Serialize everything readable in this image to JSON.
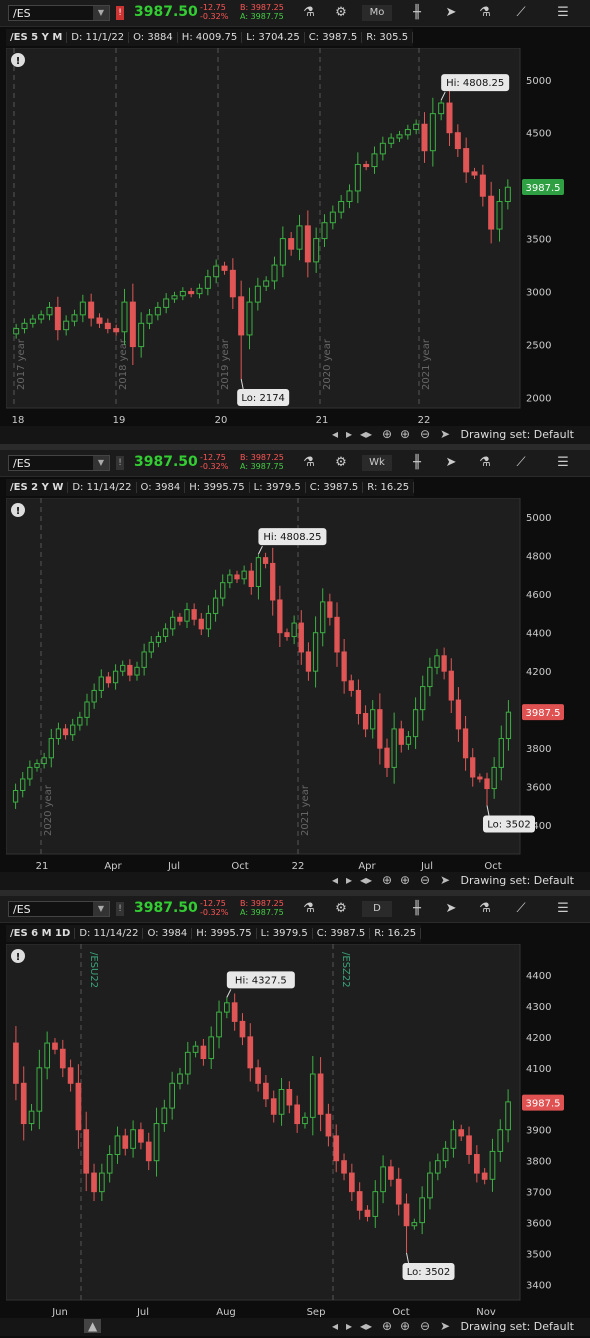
{
  "panels": [
    {
      "symbol": "/ES",
      "last": "3987.50",
      "change": "-12.75",
      "change_pct": "-0.32%",
      "bid": "B: 3987.25",
      "ask": "A: 3987.75",
      "aggregation": "Mo",
      "info": {
        "name": "/ES 5 Y M",
        "date": "D: 11/1/22",
        "open": "O: 3884",
        "high": "H: 4009.75",
        "low": "L: 3704.25",
        "close": "C: 3987.5",
        "range": "R: 305.5"
      },
      "drawing_set": "Drawing set: Default",
      "price_tag": "3987.5",
      "price_tag_color": "#2ea043",
      "hi_label": "Hi: 4808.25",
      "lo_label": "Lo: 2174"
    },
    {
      "symbol": "/ES",
      "last": "3987.50",
      "change": "-12.75",
      "change_pct": "-0.32%",
      "bid": "B: 3987.25",
      "ask": "A: 3987.75",
      "aggregation": "Wk",
      "info": {
        "name": "/ES 2 Y W",
        "date": "D: 11/14/22",
        "open": "O: 3984",
        "high": "H: 3995.75",
        "low": "L: 3979.5",
        "close": "C: 3987.5",
        "range": "R: 16.25"
      },
      "drawing_set": "Drawing set: Default",
      "price_tag": "3987.5",
      "price_tag_color": "#e05252",
      "hi_label": "Hi: 4808.25",
      "lo_label": "Lo: 3502"
    },
    {
      "symbol": "/ES",
      "last": "3987.50",
      "change": "-12.75",
      "change_pct": "-0.32%",
      "bid": "B: 3987.25",
      "ask": "A: 3987.75",
      "aggregation": "D",
      "info": {
        "name": "/ES 6 M 1D",
        "date": "D: 11/14/22",
        "open": "O: 3984",
        "high": "H: 3995.75",
        "low": "L: 3979.5",
        "close": "C: 3987.5",
        "range": "R: 16.25"
      },
      "drawing_set": "Drawing set: Default",
      "price_tag": "3987.5",
      "price_tag_color": "#e05252",
      "hi_label": "Hi: 4327.5",
      "lo_label": "Lo: 3502"
    }
  ],
  "chart_data": [
    {
      "type": "candlestick",
      "ylim": [
        1900,
        5300
      ],
      "y_ticks": [
        2000,
        2500,
        3000,
        3500,
        4000,
        4500,
        5000
      ],
      "x_ticks": [
        "18",
        "19",
        "20",
        "21",
        "22"
      ],
      "period_labels": [
        "2017 year",
        "2018 year",
        "2019 year",
        "2020 year",
        "2021 year"
      ],
      "close_path": [
        2650,
        2700,
        2740,
        2780,
        2850,
        2640,
        2720,
        2780,
        2900,
        2750,
        2700,
        2650,
        2620,
        2900,
        2480,
        2700,
        2780,
        2850,
        2930,
        2960,
        3000,
        2980,
        3030,
        3140,
        3240,
        3200,
        2950,
        2590,
        2900,
        3050,
        3100,
        3250,
        3500,
        3400,
        3620,
        3280,
        3500,
        3650,
        3750,
        3850,
        3950,
        4200,
        4180,
        4300,
        4400,
        4450,
        4480,
        4530,
        4580,
        4330,
        4680,
        4780,
        4500,
        4350,
        4130,
        4100,
        3900,
        3590,
        3850,
        3985
      ],
      "hi": 4808.25,
      "lo": 2174,
      "last": 3987.5
    },
    {
      "type": "candlestick",
      "ylim": [
        3250,
        5100
      ],
      "y_ticks": [
        3400,
        3600,
        3800,
        4000,
        4200,
        4400,
        4600,
        4800,
        5000
      ],
      "x_ticks": [
        "21",
        "Apr",
        "Jul",
        "Oct",
        "22",
        "Apr",
        "Jul",
        "Oct"
      ],
      "period_labels": [
        "2020 year",
        "2021 year"
      ],
      "close_path": [
        3580,
        3640,
        3700,
        3720,
        3750,
        3850,
        3900,
        3870,
        3920,
        3960,
        4040,
        4100,
        4170,
        4140,
        4200,
        4230,
        4180,
        4220,
        4300,
        4350,
        4380,
        4420,
        4480,
        4460,
        4520,
        4470,
        4420,
        4500,
        4580,
        4660,
        4700,
        4680,
        4720,
        4640,
        4790,
        4760,
        4570,
        4400,
        4380,
        4450,
        4300,
        4200,
        4400,
        4560,
        4480,
        4300,
        4150,
        4100,
        3980,
        3900,
        4000,
        3800,
        3700,
        3900,
        3820,
        3860,
        4000,
        4120,
        4220,
        4280,
        4200,
        4050,
        3900,
        3750,
        3650,
        3640,
        3590,
        3700,
        3850,
        3987
      ],
      "hi": 4808.25,
      "lo": 3502,
      "last": 3987.5
    },
    {
      "type": "candlestick",
      "ylim": [
        3350,
        4500
      ],
      "y_ticks": [
        3400,
        3500,
        3600,
        3700,
        3800,
        3900,
        4000,
        4100,
        4200,
        4300,
        4400
      ],
      "x_ticks": [
        "Jun",
        "Jul",
        "Aug",
        "Sep",
        "Oct",
        "Nov"
      ],
      "period_labels": [
        "/ESU22",
        "/ESZ22"
      ],
      "close_path": [
        4050,
        3920,
        3960,
        4100,
        4180,
        4160,
        4100,
        4050,
        3900,
        3760,
        3700,
        3760,
        3820,
        3880,
        3840,
        3900,
        3860,
        3800,
        3920,
        3970,
        4050,
        4080,
        4150,
        4170,
        4130,
        4200,
        4280,
        4310,
        4250,
        4200,
        4100,
        4050,
        4000,
        3950,
        4030,
        3980,
        3920,
        3940,
        4080,
        3950,
        3880,
        3800,
        3760,
        3700,
        3640,
        3620,
        3700,
        3780,
        3740,
        3660,
        3590,
        3600,
        3680,
        3760,
        3800,
        3840,
        3900,
        3880,
        3820,
        3760,
        3740,
        3830,
        3900,
        3990
      ],
      "hi": 4327.5,
      "lo": 3502,
      "last": 3987.5
    }
  ]
}
